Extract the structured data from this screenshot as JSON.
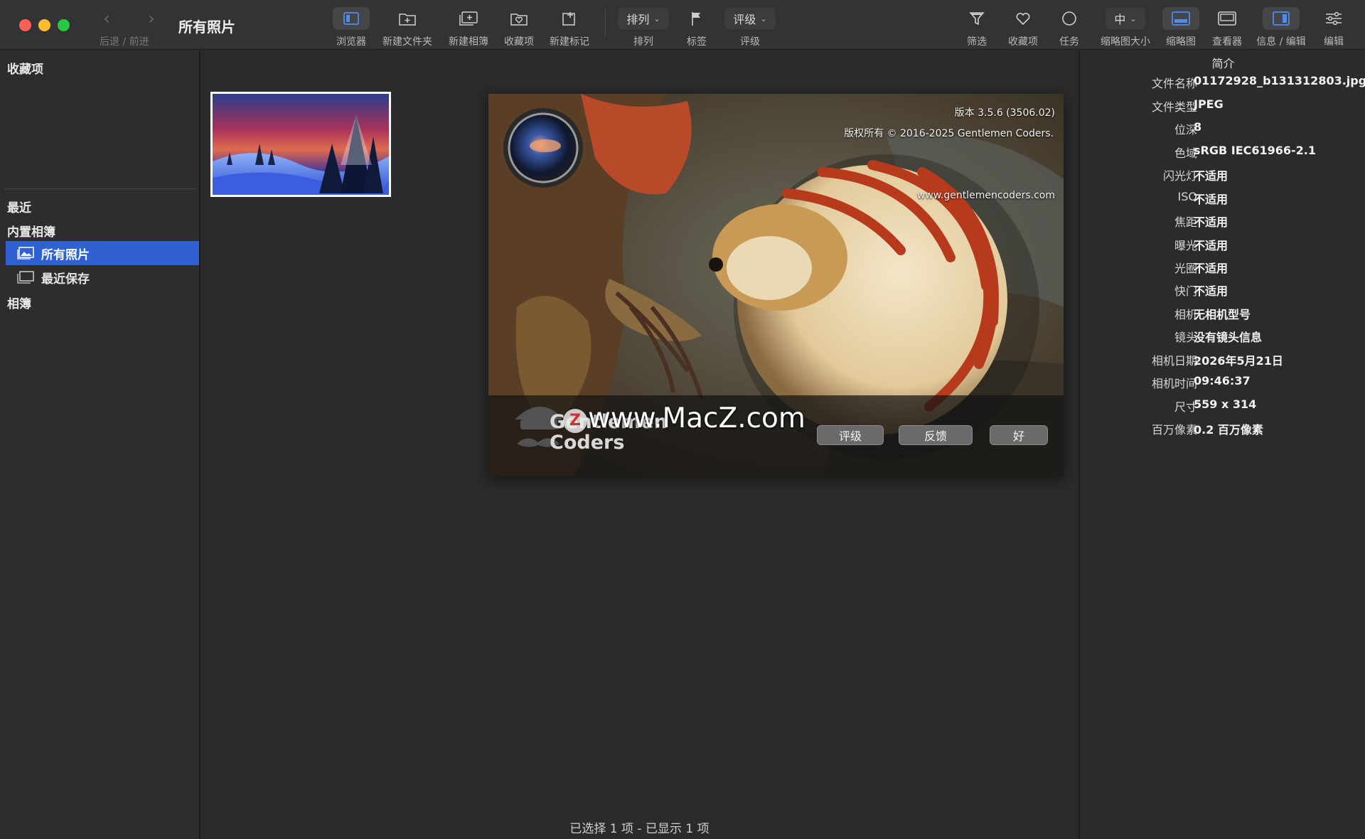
{
  "window": {
    "title": "所有照片",
    "nav_back_glyph": "‹",
    "nav_forward_glyph": "›",
    "nav_caption": "后退 / 前进"
  },
  "toolbar": {
    "browser": "浏览器",
    "new_folder": "新建文件夹",
    "new_album": "新建相簿",
    "favorites": "收藏项",
    "new_marker": "新建标记",
    "sort_value": "排列",
    "sort_label": "排列",
    "tags": "标签",
    "rating_value": "评级",
    "rating_label": "评级",
    "filter": "筛选",
    "favorites_right": "收藏项",
    "tasks": "任务",
    "thumb_size_value": "中",
    "thumb_size_label": "缩略图大小",
    "thumbnails": "缩略图",
    "viewer": "查看器",
    "info_edit": "信息 / 编辑",
    "edit": "编辑",
    "chevron": "⌄"
  },
  "sidebar": {
    "favorites_heading": "收藏项",
    "recent_heading": "最近",
    "builtin_heading": "内置相簿",
    "items": [
      {
        "label": "所有照片",
        "selected": true
      },
      {
        "label": "最近保存",
        "selected": false
      }
    ],
    "albums_heading": "相簿"
  },
  "main": {
    "status": "已选择  1 项 - 已显示 1 项"
  },
  "about": {
    "version": "版本 3.5.6 (3506.02)",
    "copyright": "版权所有 © 2016-2025 Gentlemen Coders.",
    "website": "www.gentlemencoders.com",
    "brand_line1": "Gentlemen",
    "brand_line2": "Coders",
    "watermark": "www.MacZ.com",
    "watermark_badge": "Z",
    "btn_rate": "评级",
    "btn_feedback": "反馈",
    "btn_ok": "好"
  },
  "info": {
    "title": "简介",
    "rows": [
      {
        "key": "文件名称",
        "value": "01172928_b131312803.jpg"
      },
      {
        "key": "文件类型",
        "value": "JPEG"
      },
      {
        "key": "位深",
        "value": "8"
      },
      {
        "key": "色域",
        "value": "sRGB IEC61966-2.1"
      },
      {
        "key": "闪光灯",
        "value": "不适用"
      },
      {
        "key": "ISO",
        "value": "不适用"
      },
      {
        "key": "焦距",
        "value": "不适用"
      },
      {
        "key": "曝光",
        "value": "不适用"
      },
      {
        "key": "光圈",
        "value": "不适用"
      },
      {
        "key": "快门",
        "value": "不适用"
      },
      {
        "key": "相机",
        "value": "无相机型号"
      },
      {
        "key": "镜头",
        "value": "没有镜头信息"
      },
      {
        "key": "相机日期",
        "value": "2026年5月21日"
      },
      {
        "key": "相机时间",
        "value": "09:46:37"
      },
      {
        "key": "尺寸",
        "value": "559 x 314"
      },
      {
        "key": "百万像素",
        "value": "0.2 百万像素"
      }
    ]
  },
  "colors": {
    "accent": "#2f61d3",
    "close": "#ff5f57",
    "minimize": "#febc2e",
    "zoom": "#28c840",
    "background": "#2b2b2d"
  }
}
